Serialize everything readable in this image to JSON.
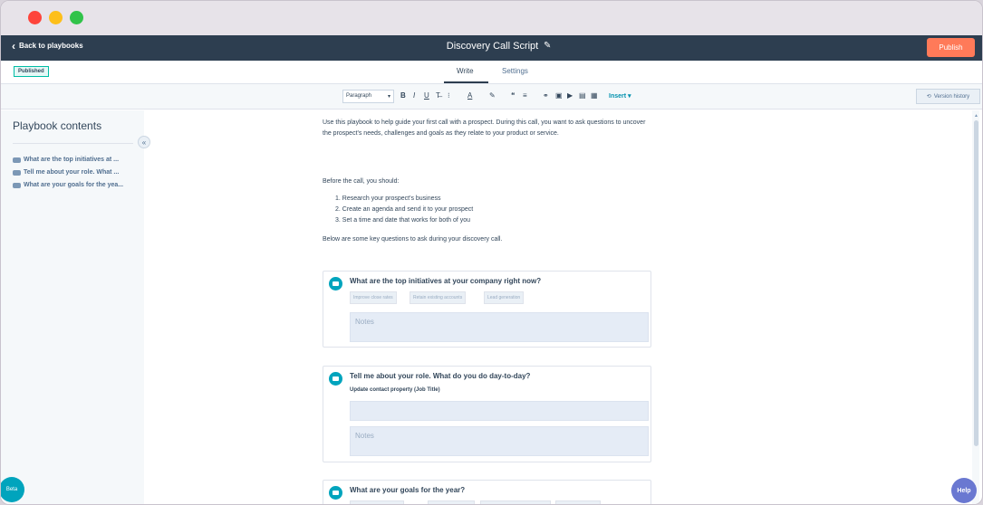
{
  "window": {
    "controls": [
      "close",
      "minimize",
      "maximize"
    ]
  },
  "topbar": {
    "back_label": "Back to playbooks",
    "title": "Discovery Call Script",
    "publish_label": "Publish"
  },
  "status": {
    "badge": "Published"
  },
  "tabs": [
    {
      "label": "Write"
    },
    {
      "label": "Settings"
    }
  ],
  "toolbar": {
    "paragraph": "Paragraph",
    "bold": "B",
    "italic": "I",
    "underline": "U",
    "clear_format": "T̶",
    "more_styles": "⁝",
    "text_color": "A",
    "highlight": "✎",
    "quote": "❝",
    "align": "≡",
    "list": "☰",
    "link": "🔗",
    "image": "▣",
    "video": "▶",
    "table": "▤",
    "snippet": "▦",
    "chat": "▣",
    "insert_label": "Insert",
    "version_history": "Version history"
  },
  "sidebar": {
    "title": "Playbook contents",
    "items": [
      {
        "label": "What are the top initiatives at ..."
      },
      {
        "label": "Tell me about your role. What ..."
      },
      {
        "label": "What are your goals for the yea..."
      }
    ]
  },
  "editor": {
    "intro": "Use this playbook to help guide your first call with a prospect. During this call, you want to ask questions to uncover the prospect's needs, challenges and goals as they relate to your product or service.",
    "before_call": "Before the call, you should:",
    "steps": [
      "Research your prospect's business",
      "Create an agenda and send it to your prospect",
      "Set a time and date that works for both of you"
    ],
    "below": "Below are some key questions to ask during your discovery call.",
    "questions": [
      {
        "title": "What are the top initiatives at your company right now?",
        "options": [
          "Improve close rates",
          "Retain existing accounts",
          "Lead generation"
        ],
        "notes_placeholder": "Notes"
      },
      {
        "title": "Tell me about your role. What do you do day-to-day?",
        "property_label": "Update contact property (Job Title)",
        "notes_placeholder": "Notes"
      },
      {
        "title": "What are your goals for the year?"
      }
    ]
  },
  "beta_label": "Beta",
  "help_label": "Help",
  "colors": {
    "topbar": "#2d3e50",
    "publish": "#ff7a59",
    "accent": "#00a4bd",
    "help": "#6a78d1",
    "badge_border": "#00bda5"
  }
}
